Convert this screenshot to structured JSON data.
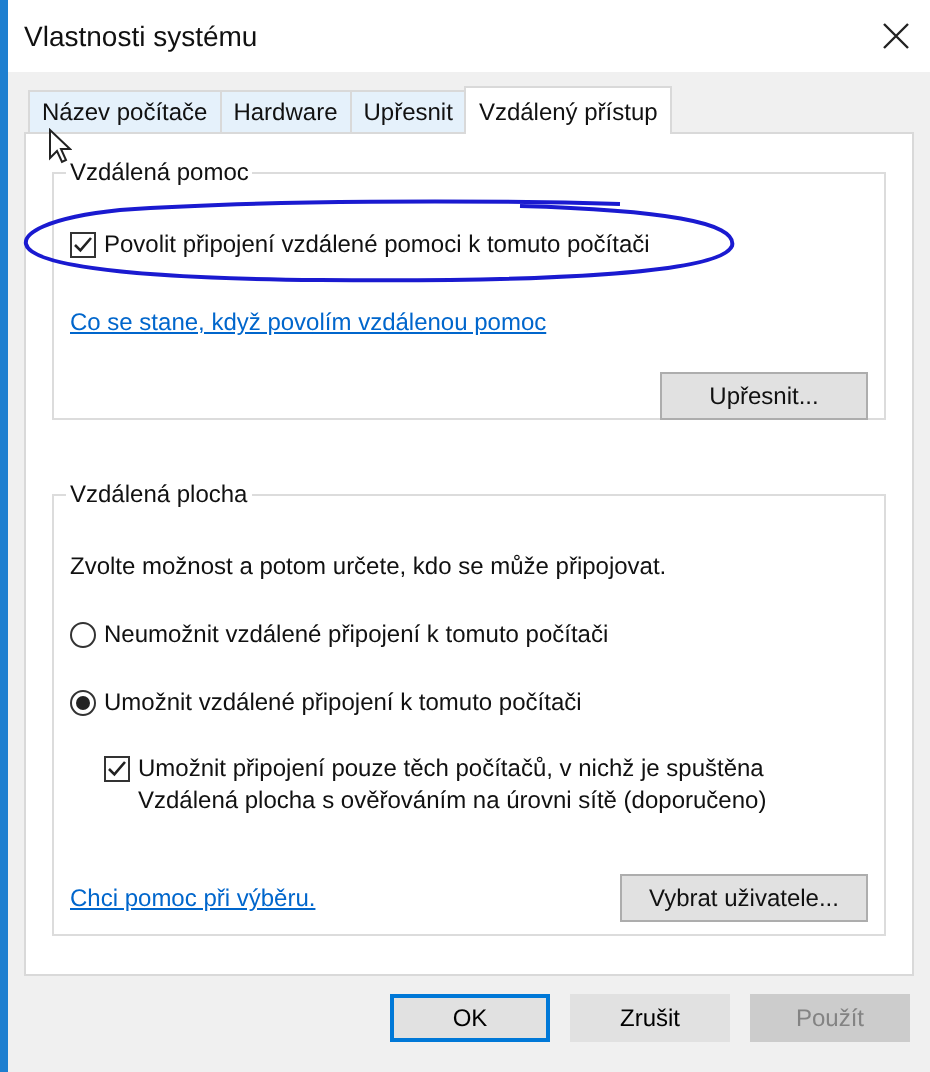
{
  "window": {
    "title": "Vlastnosti systému"
  },
  "tabs": [
    {
      "label": "Název počítače",
      "selected": false
    },
    {
      "label": "Hardware",
      "selected": false
    },
    {
      "label": "Upřesnit",
      "selected": false
    },
    {
      "label": "Vzdálený přístup",
      "selected": true
    }
  ],
  "remote_assistance": {
    "title": "Vzdálená pomoc",
    "checkbox": {
      "label": "Povolit připojení vzdálené pomoci k tomuto počítači",
      "checked": true
    },
    "link": "Co se stane, když povolím vzdálenou pomoc",
    "button": "Upřesnit..."
  },
  "remote_desktop": {
    "title": "Vzdálená plocha",
    "instruction": "Zvolte možnost a potom určete, kdo se může připojovat.",
    "options": [
      {
        "label": "Neumožnit vzdálené připojení k tomuto počítači",
        "selected": false
      },
      {
        "label": "Umožnit vzdálené připojení k tomuto počítači",
        "selected": true
      }
    ],
    "nla_checkbox": {
      "label": "Umožnit připojení pouze těch počítačů, v nichž je spuštěna Vzdálená plocha s ověřováním na úrovni sítě (doporučeno)",
      "checked": true
    },
    "link": "Chci pomoc při výběru.",
    "button": "Vybrat uživatele..."
  },
  "buttons": [
    {
      "label": "OK",
      "default": true,
      "disabled": false
    },
    {
      "label": "Zrušit",
      "default": false,
      "disabled": false
    },
    {
      "label": "Použít",
      "default": false,
      "disabled": true
    }
  ]
}
